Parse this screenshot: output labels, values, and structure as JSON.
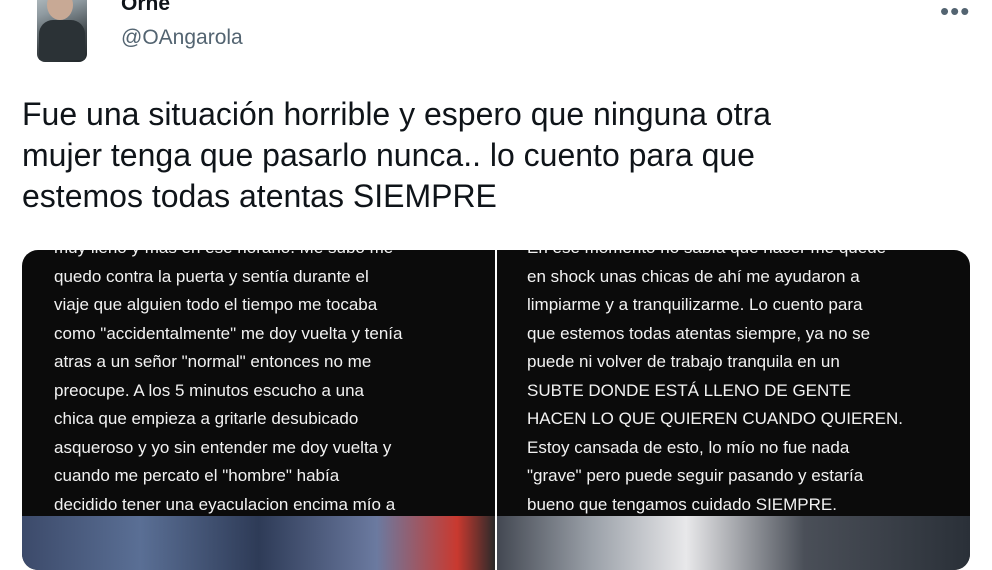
{
  "author": {
    "display_name": "Orne",
    "handle": "@OAngarola"
  },
  "more_icon_label": "•••",
  "tweet": {
    "text": "Fue una situación horrible y espero que ninguna otra\nmujer tenga que pasarlo nunca.. lo cuento para que\nestemos todas atentas SIEMPRE"
  },
  "media": {
    "left_text": "muy lleno y más en ese horario. Me subo me\nquedo contra la puerta y sentía durante el\nviaje que alguien todo el tiempo me tocaba\ncomo \"accidentalmente\" me doy vuelta y tenía\natras a un señor \"normal\" entonces no me\npreocupe. A los 5 minutos escucho a una\nchica que empieza a gritarle desubicado\nasqueroso y yo sin entender me doy vuelta y\ncuando me percato el \"hombre\" había\ndecidido tener una eyaculacion encima mío a",
    "right_text": "En ese momento no sabía que hacer me quede\nen shock unas chicas de ahí me ayudaron a\nlimpiarme y a tranquilizarme. Lo cuento para\nque estemos todas atentas siempre, ya no se\npuede ni volver de trabajo tranquila en un\nSUBTE DONDE ESTÁ LLENO DE GENTE\nHACEN LO QUE QUIEREN CUANDO QUIEREN.\nEstoy cansada de esto, lo mío no fue nada\n\"grave\" pero puede seguir pasando y estaría\nbueno que tengamos cuidado SIEMPRE."
  }
}
